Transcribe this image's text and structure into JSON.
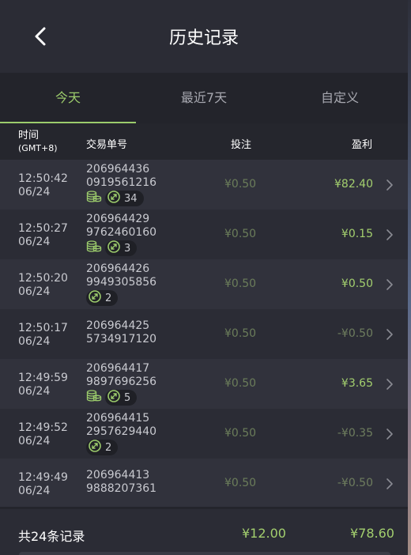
{
  "header": {
    "title": "历史记录"
  },
  "tabs": [
    {
      "label": "今天",
      "active": true
    },
    {
      "label": "最近7天",
      "active": false
    },
    {
      "label": "自定义",
      "active": false
    }
  ],
  "columns": {
    "time": "时间",
    "timezone": "(GMT+8)",
    "order": "交易单号",
    "bet": "投注",
    "profit": "盈利"
  },
  "records": [
    {
      "time": "12:50:42",
      "date": "06/24",
      "order_line1": "206964436",
      "order_line2": "0919561216",
      "coins": true,
      "badge": "34",
      "bet": "¥0.50",
      "profit": "¥82.40",
      "profit_type": "pos"
    },
    {
      "time": "12:50:27",
      "date": "06/24",
      "order_line1": "206964429",
      "order_line2": "9762460160",
      "coins": true,
      "badge": "3",
      "bet": "¥0.50",
      "profit": "¥0.15",
      "profit_type": "pos"
    },
    {
      "time": "12:50:20",
      "date": "06/24",
      "order_line1": "206964426",
      "order_line2": "9949305856",
      "coins": false,
      "badge": "2",
      "bet": "¥0.50",
      "profit": "¥0.50",
      "profit_type": "pos"
    },
    {
      "time": "12:50:17",
      "date": "06/24",
      "order_line1": "206964425",
      "order_line2": "5734917120",
      "coins": false,
      "badge": null,
      "bet": "¥0.50",
      "profit": "-¥0.50",
      "profit_type": "neg"
    },
    {
      "time": "12:49:59",
      "date": "06/24",
      "order_line1": "206964417",
      "order_line2": "9897696256",
      "coins": true,
      "badge": "5",
      "bet": "¥0.50",
      "profit": "¥3.65",
      "profit_type": "pos"
    },
    {
      "time": "12:49:52",
      "date": "06/24",
      "order_line1": "206964415",
      "order_line2": "2957629440",
      "coins": false,
      "badge": "2",
      "bet": "¥0.50",
      "profit": "-¥0.35",
      "profit_type": "neg"
    },
    {
      "time": "12:49:49",
      "date": "06/24",
      "order_line1": "206964413",
      "order_line2": "9888207361",
      "coins": false,
      "badge": null,
      "bet": "¥0.50",
      "profit": "-¥0.50",
      "profit_type": "neg"
    }
  ],
  "footer": {
    "label": "共24条记录",
    "total_bet": "¥12.00",
    "total_profit": "¥78.60"
  },
  "colors": {
    "accent": "#9ccc6c",
    "positive": "#a3cf6e",
    "negative": "#6e7d5e",
    "background": "#2b2c35"
  }
}
